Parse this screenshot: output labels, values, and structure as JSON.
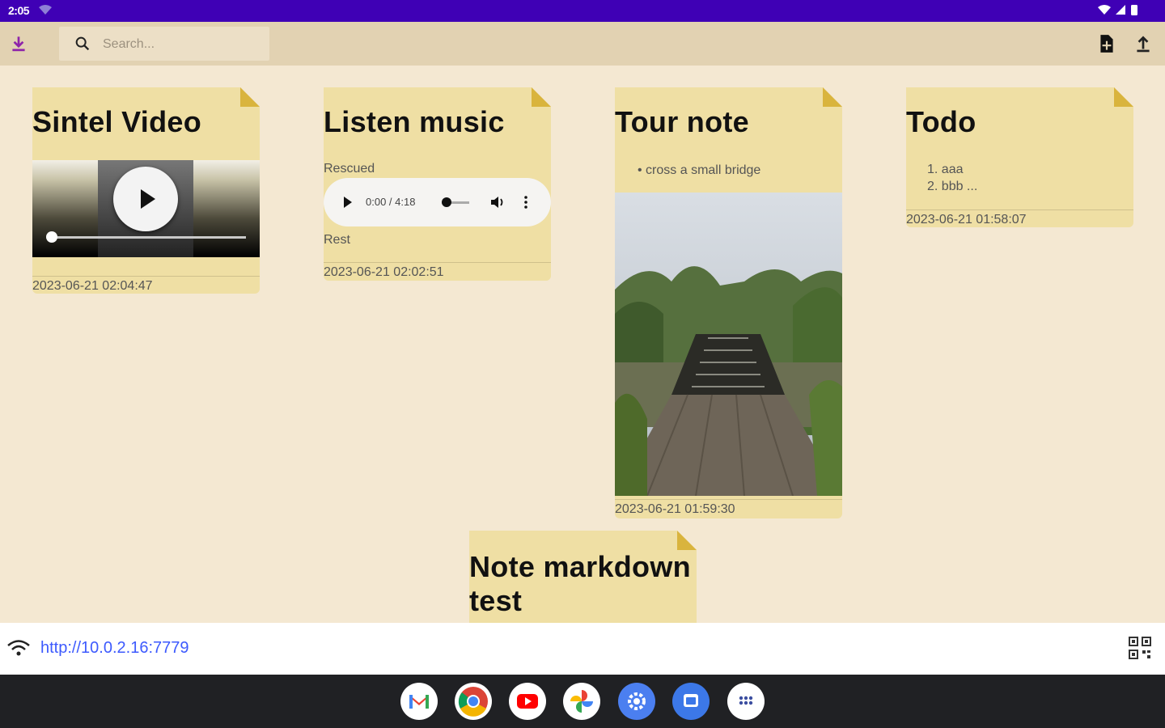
{
  "status_bar": {
    "time": "2:05"
  },
  "toolbar": {
    "search_placeholder": "Search..."
  },
  "notes": [
    {
      "title": "Sintel Video",
      "date": "2023-06-21 02:04:47"
    },
    {
      "title": "Listen music",
      "text_before": "Rescued",
      "audio_time": "0:00 / 4:18",
      "text_after": "Rest",
      "date": "2023-06-21 02:02:51"
    },
    {
      "title": "Tour note",
      "bullet": "cross a small bridge",
      "date": "2023-06-21 01:59:30"
    },
    {
      "title": "Todo",
      "items": [
        "1. aaa",
        "2. bbb ..."
      ],
      "date": "2023-06-21 01:58:07"
    },
    {
      "title_line1": "Note markdown",
      "title_line2": "test"
    }
  ],
  "url_bar": {
    "url": "http://10.0.2.16:7779"
  },
  "dock": {
    "apps": [
      "Gmail",
      "Chrome",
      "YouTube",
      "Photos",
      "Settings",
      "Files",
      "All apps"
    ]
  },
  "colors": {
    "status_bar": "#3f00b5",
    "toolbar": "#e2d2b2",
    "background": "#f4e8d2",
    "note": "#efdfa4",
    "accent": "#8e24aa",
    "url": "#3d5afe"
  }
}
